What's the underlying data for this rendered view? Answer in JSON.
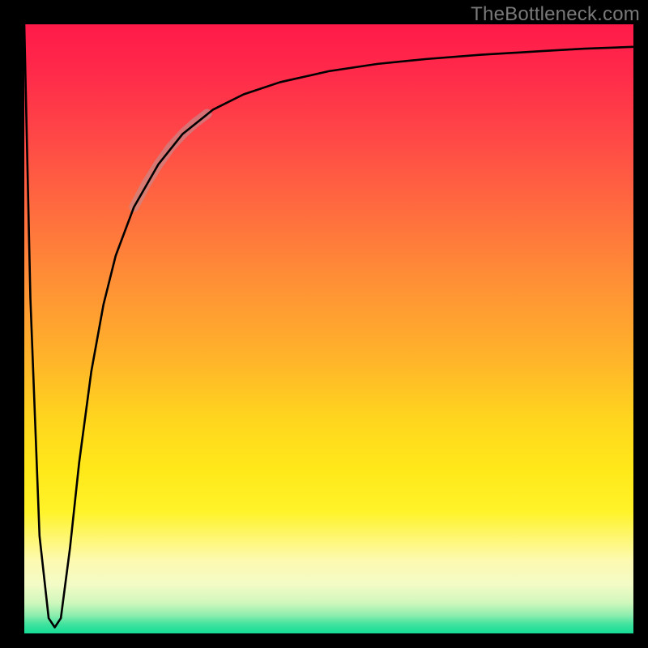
{
  "watermark": "TheBottleneck.com",
  "chart_data": {
    "type": "line",
    "title": "",
    "xlabel": "",
    "ylabel": "",
    "xlim": [
      0,
      100
    ],
    "ylim": [
      0,
      100
    ],
    "grid": false,
    "series": [
      {
        "name": "bottleneck-curve",
        "x": [
          0,
          1,
          2.5,
          4,
          5,
          6,
          7.5,
          9,
          11,
          13,
          15,
          18,
          22,
          26,
          31,
          36,
          42,
          50,
          58,
          66,
          75,
          85,
          92,
          100
        ],
        "values": [
          100,
          55,
          16,
          2.5,
          1,
          2.5,
          14,
          28,
          43,
          54,
          62,
          70,
          77,
          82,
          86,
          88.5,
          90.5,
          92.3,
          93.5,
          94.3,
          95,
          95.6,
          96,
          96.3
        ]
      },
      {
        "name": "highlight-segment",
        "x": [
          18,
          20,
          22,
          24,
          26,
          28,
          30
        ],
        "values": [
          70,
          73.8,
          77,
          79.8,
          82,
          83.8,
          85.3
        ]
      }
    ],
    "background_gradient": {
      "direction": "top-to-bottom",
      "stops": [
        {
          "pos": 0.0,
          "color": "#ff1a49"
        },
        {
          "pos": 0.3,
          "color": "#ff6a3f"
        },
        {
          "pos": 0.55,
          "color": "#ffb42a"
        },
        {
          "pos": 0.73,
          "color": "#ffe81a"
        },
        {
          "pos": 0.92,
          "color": "#f3fbc6"
        },
        {
          "pos": 1.0,
          "color": "#16dc95"
        }
      ]
    },
    "highlight_style": {
      "color": "#c38a8e",
      "width": 12,
      "opacity": 0.65
    }
  }
}
